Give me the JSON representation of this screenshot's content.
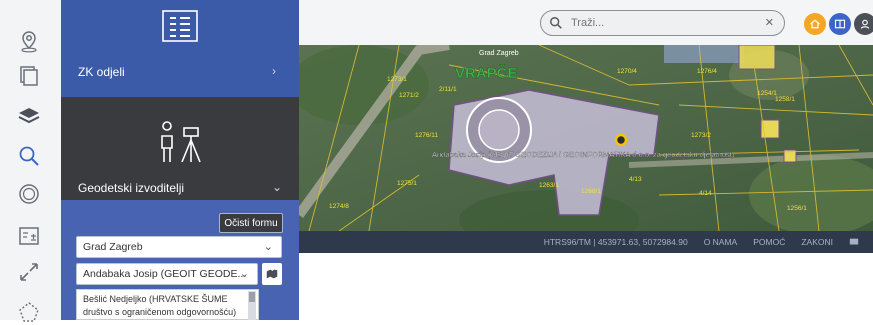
{
  "rail": {
    "icons": [
      "location-pin-icon",
      "layers-copy-icon",
      "stack-layers-icon",
      "search-icon",
      "coin-icon",
      "calculator-map-icon",
      "expand-arrows-icon",
      "polygon-icon"
    ]
  },
  "panel": {
    "zk_label": "ZK odjeli",
    "zk_chevron": "›",
    "geo_label": "Geodetski izvoditelji",
    "geo_chevron": "⌄",
    "clear_button": "Očisti formu",
    "city_select": "Grad Zagreb",
    "surveyor_select": "Andabaka Josip (GEOIT GEODE...",
    "dropdown_item": "Bešlić Nedjeljko (HRVATSKE ŠUME društvo s ograničenom odgovornošću)"
  },
  "search": {
    "placeholder": "Traži..."
  },
  "map": {
    "district_label": "VRAPČE",
    "street_label": "Grad Zagreb",
    "popup_label": "Andabaka Josip (GEOIT GEODEZIJA i GEOINFORMATIKA d.o.o. za geodetsku djelatnost)",
    "parcel_labels": [
      "1273/1",
      "1271/2",
      "2/11/1",
      "1276/11",
      "1275/1",
      "1274/8",
      "1270/4",
      "1276/4",
      "1254/1",
      "1258/1",
      "1273/2",
      "1263/1",
      "1268/1",
      "4/13",
      "4/14",
      "1256/1"
    ]
  },
  "status": {
    "coords": "HTRS96/TM | 453971.63, 5072984.90",
    "links": [
      "O NAMA",
      "POMOĆ",
      "ZAKONI"
    ]
  },
  "colors": {
    "panel_dark": "#3a3b3f",
    "panel_blue": "#3b5aa8",
    "filter_blue": "#4863b2",
    "status_bar": "#2e3a4c",
    "home": "#f5a623",
    "accent": "#3e64c8"
  }
}
